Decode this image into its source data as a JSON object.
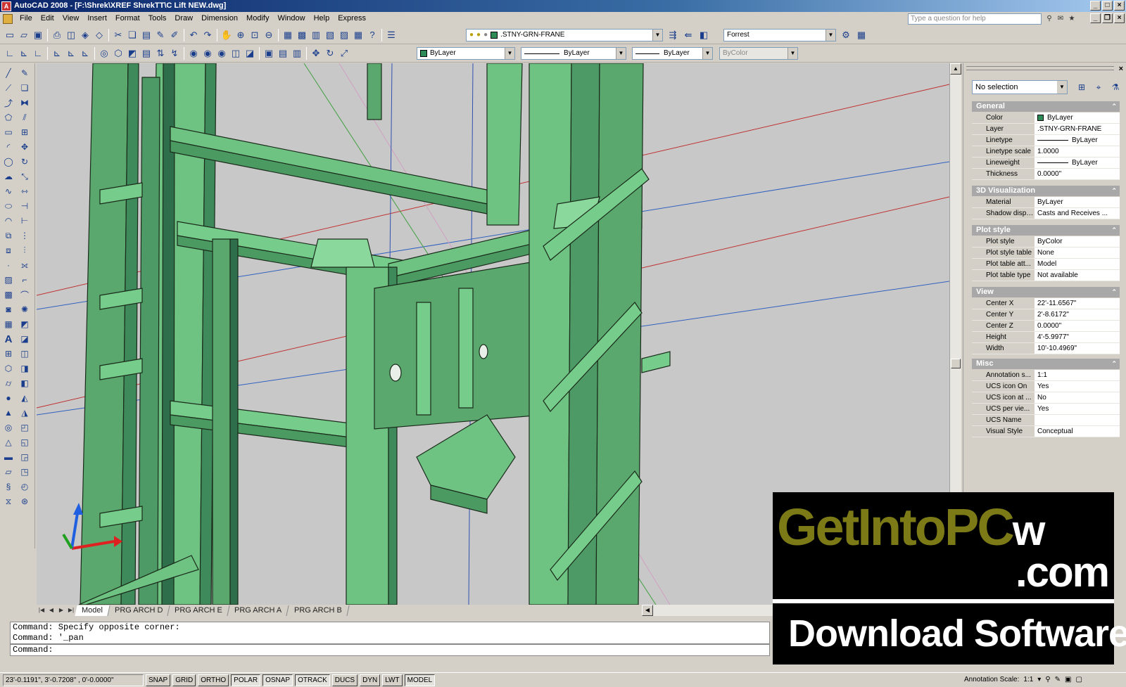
{
  "window": {
    "title": "AutoCAD 2008 - [F:\\Shrek\\XREF ShrekTT\\C Lift NEW.dwg]"
  },
  "menu": [
    "File",
    "Edit",
    "View",
    "Insert",
    "Format",
    "Tools",
    "Draw",
    "Dimension",
    "Modify",
    "Window",
    "Help",
    "Express"
  ],
  "help_search": {
    "placeholder": "Type a question for help"
  },
  "toolbar": {
    "layer_combo": ".STNY-GRN-FRANE",
    "layer_color": "#2e8b57",
    "text_style": "Forrest",
    "color_combo": "ByLayer",
    "linetype_combo": "ByLayer",
    "lineweight_combo": "ByLayer",
    "plotstyle_combo": "ByColor"
  },
  "tabs": [
    "Model",
    "PRG ARCH D",
    "PRG ARCH E",
    "PRG ARCH A",
    "PRG ARCH B"
  ],
  "active_tab": "Model",
  "properties": {
    "selection": "No selection",
    "general": {
      "title": "General",
      "rows": [
        {
          "key": "Color",
          "value": "ByLayer"
        },
        {
          "key": "Layer",
          "value": ".STNY-GRN-FRANE"
        },
        {
          "key": "Linetype",
          "value": "ByLayer"
        },
        {
          "key": "Linetype scale",
          "value": "1.0000"
        },
        {
          "key": "Lineweight",
          "value": "ByLayer"
        },
        {
          "key": "Thickness",
          "value": "0.0000\""
        }
      ]
    },
    "viz": {
      "title": "3D Visualization",
      "rows": [
        {
          "key": "Material",
          "value": "ByLayer"
        },
        {
          "key": "Shadow display",
          "value": "Casts and Receives ..."
        }
      ]
    },
    "plot": {
      "title": "Plot style",
      "rows": [
        {
          "key": "Plot style",
          "value": "ByColor"
        },
        {
          "key": "Plot style table",
          "value": "None"
        },
        {
          "key": "Plot table att...",
          "value": "Model"
        },
        {
          "key": "Plot table type",
          "value": "Not available"
        }
      ]
    },
    "view": {
      "title": "View",
      "rows": [
        {
          "key": "Center X",
          "value": "22'-11.6567\""
        },
        {
          "key": "Center Y",
          "value": "2'-8.6172\""
        },
        {
          "key": "Center Z",
          "value": "0.0000\""
        },
        {
          "key": "Height",
          "value": "4'-5.9977\""
        },
        {
          "key": "Width",
          "value": "10'-10.4969\""
        }
      ]
    },
    "misc": {
      "title": "Misc",
      "rows": [
        {
          "key": "Annotation s...",
          "value": "1:1"
        },
        {
          "key": "UCS icon On",
          "value": "Yes"
        },
        {
          "key": "UCS icon at ...",
          "value": "No"
        },
        {
          "key": "UCS per vie...",
          "value": "Yes"
        },
        {
          "key": "UCS Name",
          "value": ""
        },
        {
          "key": "Visual Style",
          "value": "Conceptual"
        }
      ]
    }
  },
  "command": {
    "history": [
      "Command: Specify opposite corner:",
      "Command: '_pan"
    ],
    "prompt": "Command:"
  },
  "status": {
    "coords": "23'-0.1191\", 3'-0.7208\" , 0'-0.0000\"",
    "buttons": [
      "SNAP",
      "GRID",
      "ORTHO",
      "POLAR",
      "OSNAP",
      "OTRACK",
      "DUCS",
      "DYN",
      "LWT",
      "MODEL"
    ],
    "annotation_label": "Annotation Scale:",
    "annotation_value": "1:1"
  },
  "watermark": {
    "brand_a": "GetInto",
    "brand_b": "PC",
    "brand_c": "w",
    "domain": ".com",
    "tagline": "Download Software"
  }
}
